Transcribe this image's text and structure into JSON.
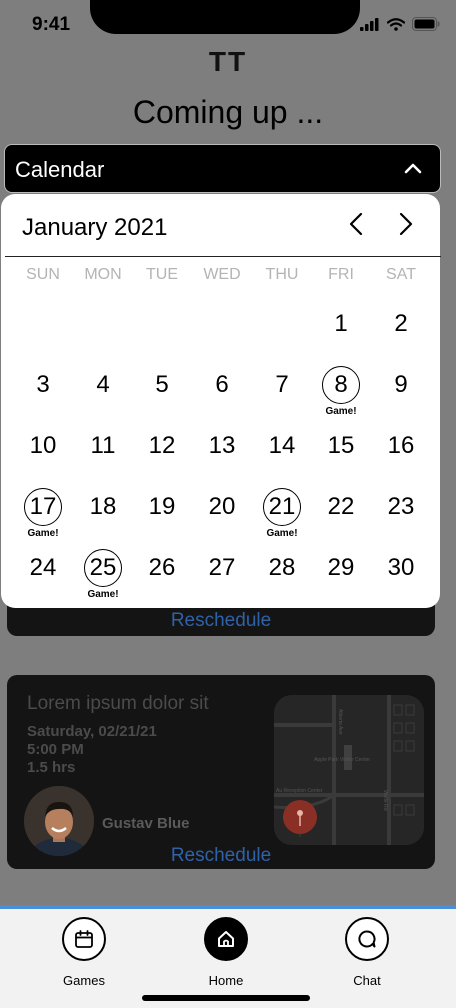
{
  "status_bar": {
    "time": "9:41"
  },
  "header": {
    "logo": "TT",
    "title": "Coming up ..."
  },
  "dropdown": {
    "label": "Calendar"
  },
  "calendar": {
    "month_label": "January 2021",
    "weekdays": [
      "SUN",
      "MON",
      "TUE",
      "WED",
      "THU",
      "FRI",
      "SAT"
    ],
    "days": [
      "1",
      "2",
      "3",
      "4",
      "5",
      "6",
      "7",
      "8",
      "9",
      "10",
      "11",
      "12",
      "13",
      "14",
      "15",
      "16",
      "17",
      "18",
      "19",
      "20",
      "21",
      "22",
      "23",
      "24",
      "25",
      "26",
      "27",
      "28",
      "29",
      "30"
    ],
    "first_weekday_index": 5,
    "game_days": [
      8,
      17,
      21,
      25
    ],
    "game_label": "Game!"
  },
  "events": [
    {
      "reschedule_label": "Reschedule"
    },
    {
      "title": "Lorem ipsum dolor sit",
      "date": "Saturday, 02/21/21",
      "time": "5:00 PM",
      "duration": "1.5 hrs",
      "person": "Gustav Blue",
      "reschedule_label": "Reschedule",
      "map_labels": [
        "Apple Park Visitor Center",
        "Au Reception Center",
        "Alberta Ave",
        "Wolfe Rd"
      ]
    }
  ],
  "tab_bar": {
    "tabs": [
      {
        "label": "Games",
        "icon": "calendar-icon",
        "active": false
      },
      {
        "label": "Home",
        "icon": "home-icon",
        "active": true
      },
      {
        "label": "Chat",
        "icon": "chat-icon",
        "active": false
      }
    ]
  },
  "colors": {
    "overlay": "#7e7e7e",
    "card": "#141414",
    "link": "#2f62a8",
    "tab_accent": "#4a90d9"
  }
}
